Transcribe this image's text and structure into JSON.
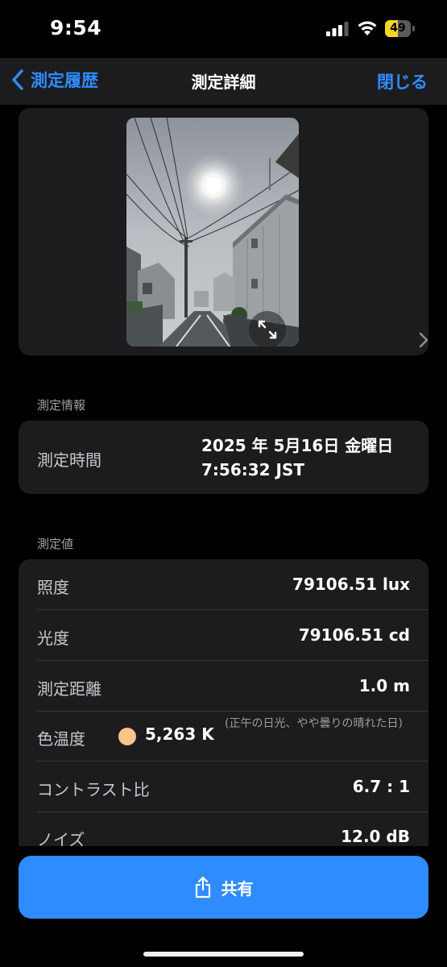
{
  "status_bar": {
    "time": "9:54",
    "battery_percent": "49",
    "battery_level": 0.49,
    "battery_color": "#f6d52b"
  },
  "nav": {
    "back_label": "測定履歴",
    "title": "測定詳細",
    "close_label": "閉じる",
    "accent_color": "#2f8cff"
  },
  "photo": {
    "expand_icon": "expand-arrows-icon",
    "next_icon": "chevron-right-icon"
  },
  "info_section": {
    "header": "測定情報",
    "time_label": "測定時間",
    "time_line1": "2025 年 5月16日 金曜日",
    "time_line2": "7:56:32 JST"
  },
  "values_section": {
    "header": "測定値",
    "rows": [
      {
        "label": "照度",
        "value": "79106.51 lux"
      },
      {
        "label": "光度",
        "value": "79106.51 cd"
      },
      {
        "label": "測定距離",
        "value": "1.0 m"
      },
      {
        "label": "色温度",
        "value": "5,263 K",
        "note": "(正午の日光、やや曇りの晴れた日)",
        "swatch_color": "#fec388"
      },
      {
        "label": "コントラスト比",
        "value": "6.7 : 1"
      },
      {
        "label": "ノイズ",
        "value": "12.0 dB"
      }
    ]
  },
  "share_button": {
    "label": "共有",
    "icon": "share-icon"
  }
}
